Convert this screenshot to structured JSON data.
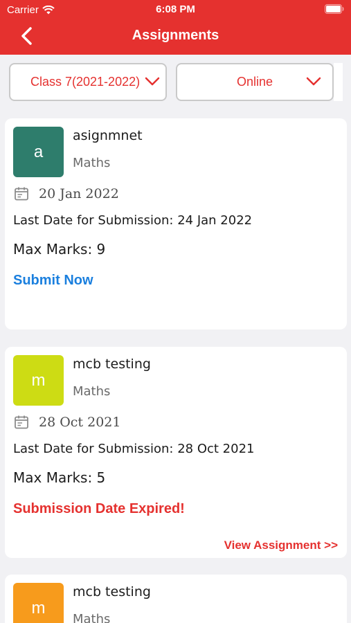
{
  "status_bar": {
    "carrier": "Carrier",
    "time": "6:08 PM"
  },
  "nav": {
    "title": "Assignments",
    "back_icon": "chevron-left-icon"
  },
  "filters": {
    "class_value": "Class 7(2021-2022)",
    "mode_value": "Online"
  },
  "colors": {
    "header": "#e5312f",
    "link_blue": "#1a7fde",
    "expired_red": "#e5312f"
  },
  "assignments": [
    {
      "avatar_letter": "a",
      "avatar_color": "#2e7d6c",
      "title": "asignmnet",
      "subject": "Maths",
      "date": "20 Jan 2022",
      "last_date": "Last Date for Submission: 24 Jan 2022",
      "max_marks": "Max Marks: 9",
      "action": "Submit Now"
    },
    {
      "avatar_letter": "m",
      "avatar_color": "#cddc14",
      "title": "mcb testing",
      "subject": "Maths",
      "date": "28 Oct 2021",
      "last_date": "Last Date for Submission: 28 Oct 2021",
      "max_marks": "Max Marks: 5",
      "status": "Submission Date Expired!",
      "view_link": "View Assignment >>"
    },
    {
      "avatar_letter": "m",
      "avatar_color": "#f79b1c",
      "title": "mcb testing",
      "subject": "Maths"
    }
  ]
}
